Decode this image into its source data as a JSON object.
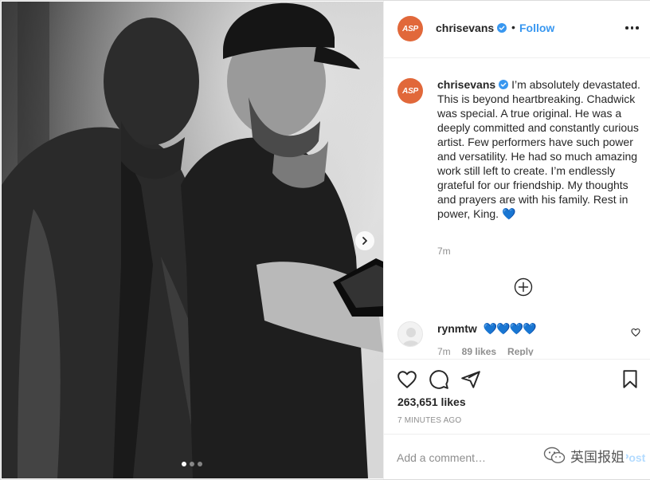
{
  "header": {
    "avatar_text": "ASP",
    "username": "chrisevans",
    "separator": "•",
    "follow_label": "Follow"
  },
  "caption": {
    "username": "chrisevans",
    "text": "I’m absolutely devastated. This is beyond heartbreaking. Chadwick was special. A true original. He was a deeply committed and constantly curious artist. Few performers have such power and versatility. He had so much amazing work still left to create. I’m endlessly grateful for our friendship. My thoughts and prayers are with his family. Rest in power, King.",
    "emoji": "💙",
    "time": "7m"
  },
  "comment": {
    "username": "rynmtw",
    "text": "💙💙💙💙",
    "time": "7m",
    "likes": "89 likes",
    "reply": "Reply"
  },
  "footer": {
    "likes": "263,651 likes",
    "posted": "7 MINUTES AGO",
    "input_placeholder": "Add a comment…",
    "post_label": "Post"
  },
  "watermark": "英国报姐",
  "carousel": {
    "slides": 3,
    "active_index": 0
  },
  "colors": {
    "accent": "#3897f0",
    "avatar": "#e1683a",
    "muted": "#8e8e8e",
    "text": "#262626"
  },
  "icons": [
    "verified-badge-icon",
    "more-options-icon",
    "load-more-comments-icon",
    "heart-icon",
    "comment-icon",
    "share-icon",
    "bookmark-icon",
    "next-slide-icon"
  ]
}
